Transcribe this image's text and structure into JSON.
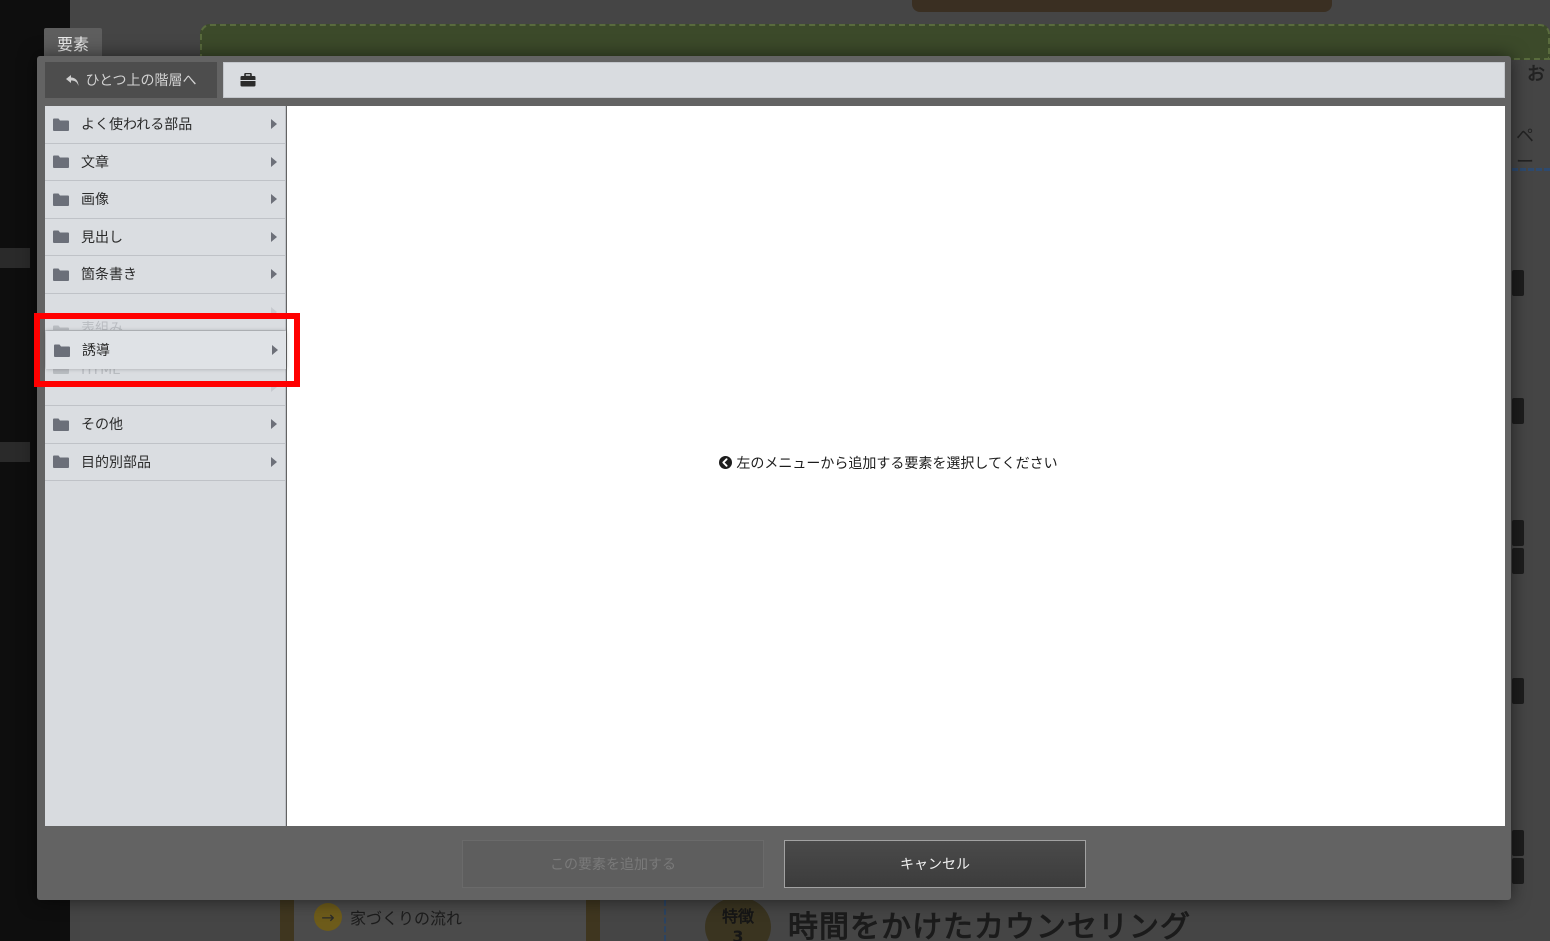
{
  "dialog": {
    "tab_label": "要素",
    "up_button_label": "ひとつ上の階層へ",
    "up_button_icon": "undo-arrow-icon",
    "path_icon": "briefcase-icon",
    "hint_text": "左のメニューから追加する要素を選択してください",
    "hint_icon": "arrow-circle-left-icon",
    "add_button_label": "この要素を追加する",
    "cancel_button_label": "キャンセル"
  },
  "menu": {
    "items": [
      {
        "label": "よく使われる部品"
      },
      {
        "label": "文章"
      },
      {
        "label": "画像"
      },
      {
        "label": "見出し"
      },
      {
        "label": "箇条書き"
      },
      {
        "label": "表組み"
      },
      {
        "label": "誘導"
      },
      {
        "label": "HTML"
      },
      {
        "label": "その他"
      },
      {
        "label": "目的別部品"
      }
    ]
  },
  "highlight": {
    "item_label": "誘導",
    "color": "#ff0000"
  },
  "background": {
    "flow_label": "家づくりの流れ",
    "feature_badge": "特徴",
    "feature_number": "3",
    "heading": "時間をかけたカウンセリング",
    "top_right_text": "お",
    "right_text": "ペー"
  }
}
